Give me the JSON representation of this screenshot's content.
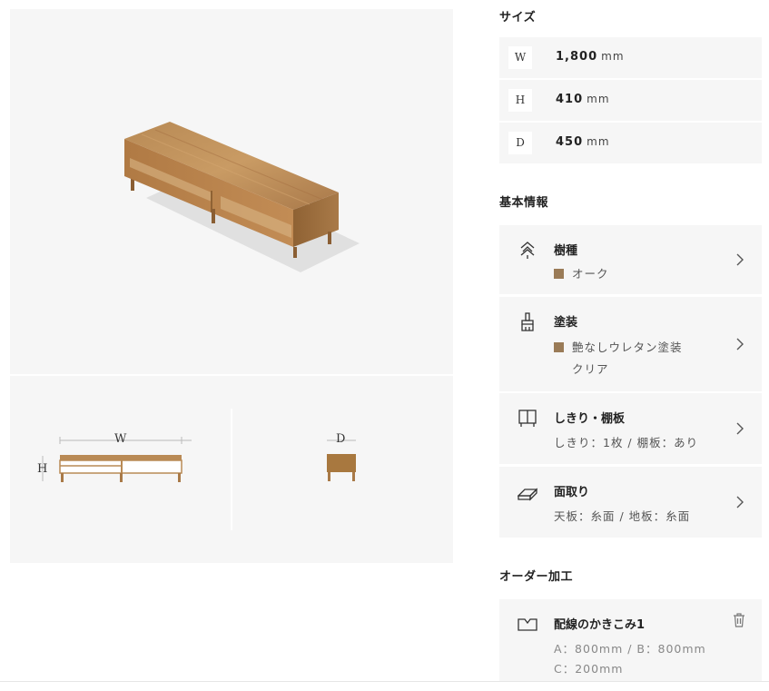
{
  "dimension_labels": {
    "w": "W",
    "h": "H",
    "d": "D"
  },
  "size": {
    "title": "サイズ",
    "unit": "mm",
    "rows": [
      {
        "key": "W",
        "value": "1,800"
      },
      {
        "key": "H",
        "value": "410"
      },
      {
        "key": "D",
        "value": "450"
      }
    ]
  },
  "basic_info": {
    "title": "基本情報",
    "items": [
      {
        "icon": "tree-icon",
        "title": "樹種",
        "lines": [
          "オーク"
        ],
        "swatch_color": "#9a7b57"
      },
      {
        "icon": "brush-icon",
        "title": "塗装",
        "lines": [
          "艶なしウレタン塗装",
          "クリア"
        ],
        "swatch_color": "#9a7b57"
      },
      {
        "icon": "shelf-icon",
        "title": "しきり・棚板",
        "lines": [
          "しきり：1枚 / 棚板：あり"
        ]
      },
      {
        "icon": "eraser-icon",
        "title": "面取り",
        "lines": [
          "天板：糸面 / 地板：糸面"
        ]
      }
    ]
  },
  "order": {
    "title": "オーダー加工",
    "items": [
      {
        "icon": "notch-icon",
        "title": "配線のかきこみ1",
        "lines": [
          "A：800mm / B：800mm",
          "C：200mm"
        ]
      }
    ]
  }
}
